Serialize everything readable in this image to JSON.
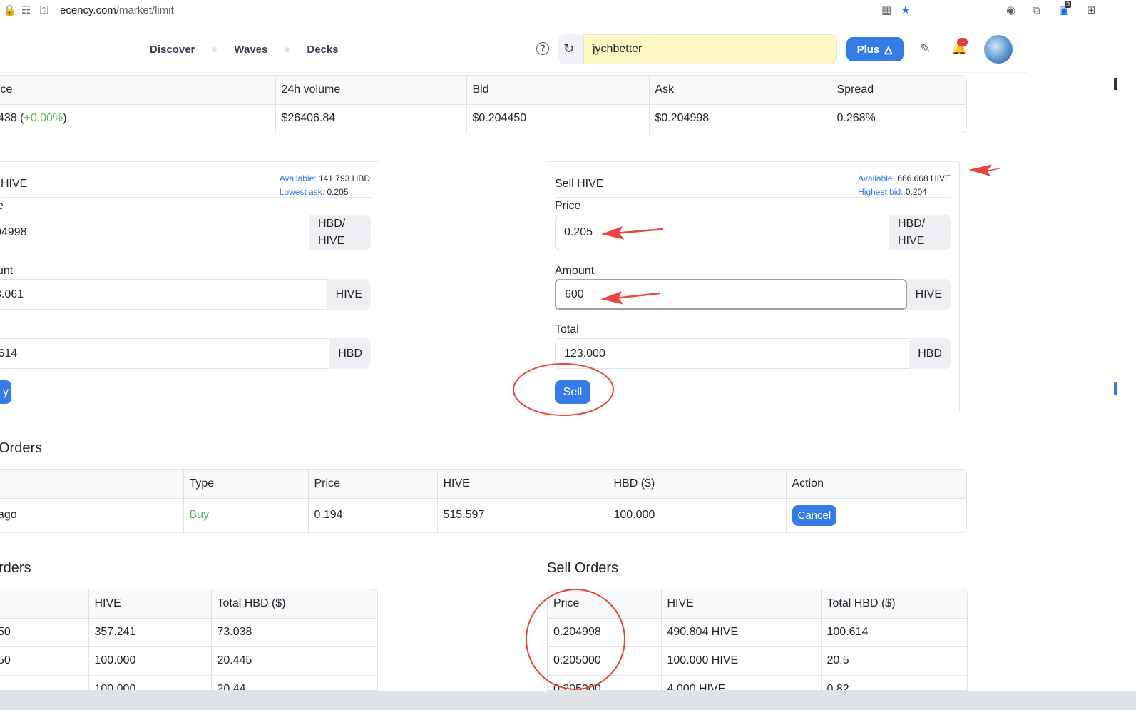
{
  "browser": {
    "url_domain": "ecency.com",
    "url_path": "/market/limit",
    "ext_badge": "3"
  },
  "nav": {
    "items": [
      "Discover",
      "Waves",
      "Decks"
    ]
  },
  "search": {
    "value": "jychbetter"
  },
  "header": {
    "plus_label": "Plus",
    "bell_badge": "..."
  },
  "stats": {
    "headers": [
      "ice",
      "24h volume",
      "Bid",
      "Ask",
      "Spread"
    ],
    "price_prefix": "438 (",
    "price_change": "+0.00%",
    "price_suffix": ")",
    "volume": "$26406.84",
    "bid": "$0.204450",
    "ask": "$0.204998",
    "spread": "0.268%"
  },
  "buy_form": {
    "title": "HIVE",
    "available_label": "Available:",
    "available_value": "141.793 HBD",
    "lowest_label": "Lowest ask:",
    "lowest_value": "0.205",
    "price_label": "e",
    "price_value": "04998",
    "price_unit_1": "HBD/",
    "price_unit_2": "HIVE",
    "amount_label": "unt",
    "amount_value": "3.061",
    "amount_unit": "HIVE",
    "total_value": ".614",
    "total_unit": "HBD",
    "button": "y"
  },
  "sell_form": {
    "title": "Sell HIVE",
    "available_label": "Available:",
    "available_value": "666.668 HIVE",
    "highest_label": "Highest bid:",
    "highest_value": "0.204",
    "price_label": "Price",
    "price_value": "0.205",
    "price_unit_1": "HBD/",
    "price_unit_2": "HIVE",
    "amount_label": "Amount",
    "amount_value": "600",
    "amount_unit": "HIVE",
    "total_label": "Total",
    "total_value": "123.000",
    "total_unit": "HBD",
    "button": "Sell"
  },
  "open_orders": {
    "title": "Orders",
    "headers": [
      "",
      "Type",
      "Price",
      "HIVE",
      "HBD ($)",
      "Action"
    ],
    "row": {
      "date": "ago",
      "type": "Buy",
      "price": "0.194",
      "hive": "515.597",
      "hbd": "100.000",
      "action": "Cancel"
    }
  },
  "buy_orders": {
    "title": "rders",
    "headers": [
      "",
      "HIVE",
      "Total HBD ($)"
    ],
    "rows": [
      [
        "50",
        "357.241",
        "73.038"
      ],
      [
        "50",
        "100.000",
        "20.445"
      ],
      [
        "",
        "100.000",
        "20.44"
      ]
    ]
  },
  "sell_orders": {
    "title": "Sell Orders",
    "headers": [
      "Price",
      "HIVE",
      "Total HBD ($)"
    ],
    "rows": [
      [
        "0.204998",
        "490.804 HIVE",
        "100.614"
      ],
      [
        "0.205000",
        "100.000 HIVE",
        "20.5"
      ],
      [
        "0.205000",
        "4.000 HIVE",
        "0.82"
      ]
    ]
  }
}
